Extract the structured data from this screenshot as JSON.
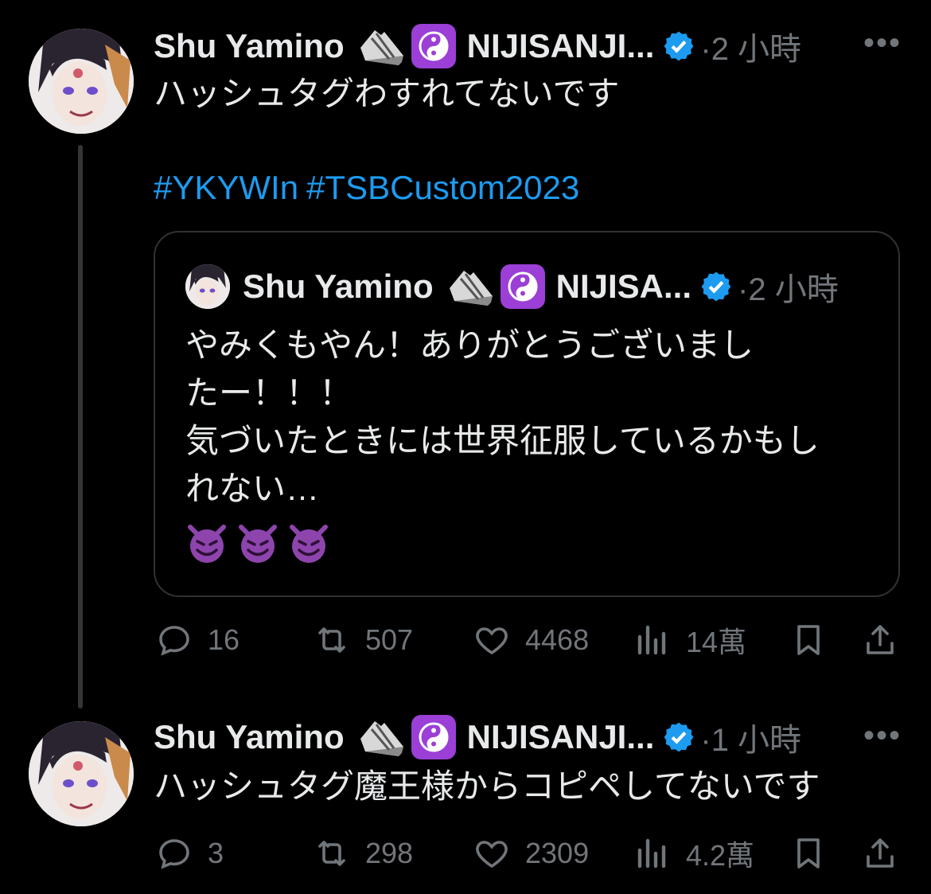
{
  "tweets": [
    {
      "name": "Shu Yamino",
      "handle": "NIJISANJI...",
      "time": "·2 小時",
      "text": "ハッシュタグわすれてないです",
      "hashtags": [
        "#YKYWIn",
        "#TSBCustom2023"
      ],
      "quote": {
        "name": "Shu Yamino",
        "handle": "NIJISA...",
        "time": "·2 小時",
        "text": "やみくもやん！ありがとうございまし\nたー！！！\n気づいたときには世界征服しているかもし\nれない…"
      },
      "stats": {
        "replies": "16",
        "retweets": "507",
        "likes": "4468",
        "views": "14萬"
      }
    },
    {
      "name": "Shu Yamino",
      "handle": "NIJISANJI...",
      "time": "·1 小時",
      "text": "ハッシュタグ魔王様からコピペしてないです",
      "stats": {
        "replies": "3",
        "retweets": "298",
        "likes": "2309",
        "views": "4.2萬"
      }
    }
  ],
  "more_label": "•••",
  "colors": {
    "link": "#1d9bf0",
    "muted": "#71767b",
    "verified": "#1d9bf0",
    "yinyang_bg": "#9b3fd6"
  },
  "icons": [
    "shoe-emoji",
    "yin-yang-emoji",
    "verified-badge-icon",
    "smiling-devil-emoji",
    "reply-icon",
    "retweet-icon",
    "like-icon",
    "views-icon",
    "bookmark-icon",
    "share-icon",
    "more-icon"
  ]
}
